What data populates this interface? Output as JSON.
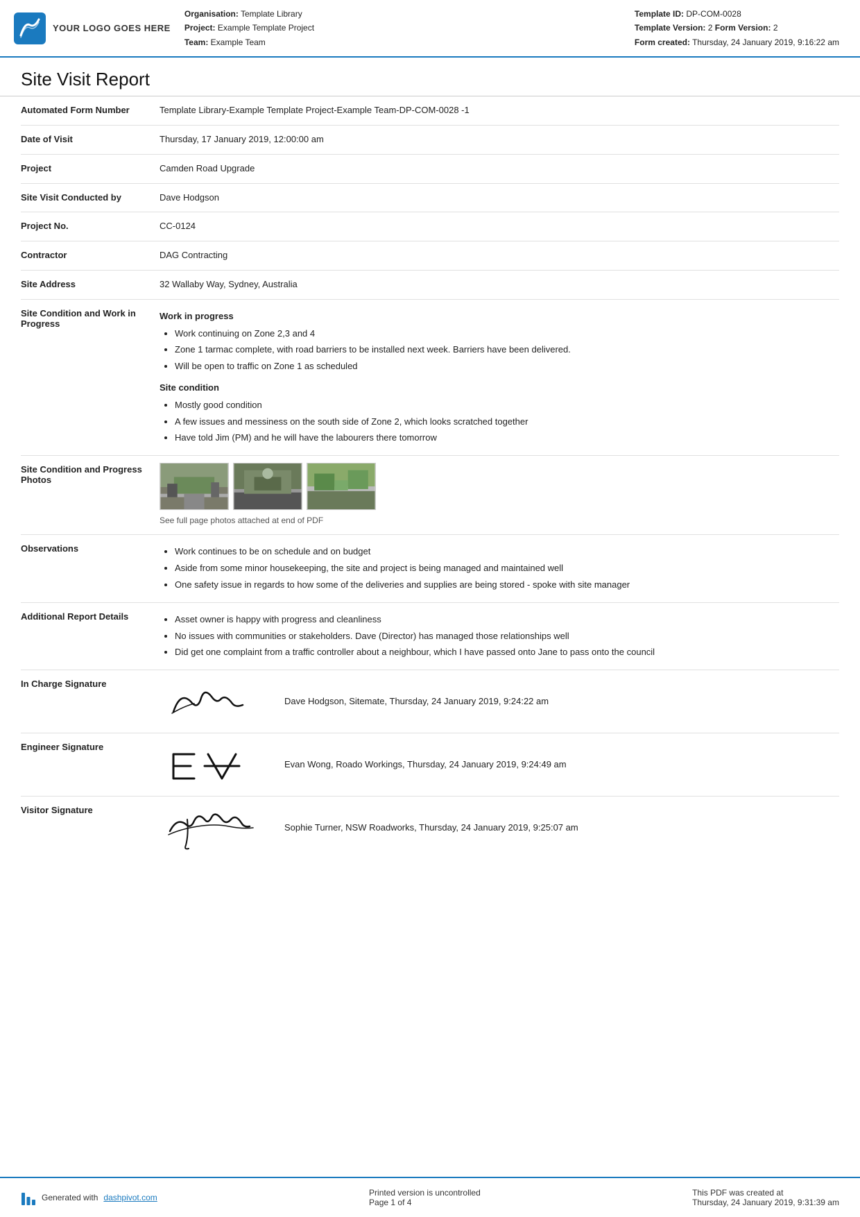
{
  "header": {
    "logo_text": "YOUR LOGO GOES HERE",
    "org_label": "Organisation:",
    "org_value": "Template Library",
    "project_label": "Project:",
    "project_value": "Example Template Project",
    "team_label": "Team:",
    "team_value": "Example Team",
    "template_id_label": "Template ID:",
    "template_id_value": "DP-COM-0028",
    "template_version_label": "Template Version:",
    "template_version_value": "2",
    "form_version_label": "Form Version:",
    "form_version_value": "2",
    "form_created_label": "Form created:",
    "form_created_value": "Thursday, 24 January 2019, 9:16:22 am"
  },
  "report": {
    "title": "Site Visit Report",
    "fields": [
      {
        "label": "Automated Form Number",
        "value": "Template Library-Example Template Project-Example Team-DP-COM-0028   -1"
      },
      {
        "label": "Date of Visit",
        "value": "Thursday, 17 January 2019, 12:00:00 am"
      },
      {
        "label": "Project",
        "value": "Camden Road Upgrade"
      },
      {
        "label": "Site Visit Conducted by",
        "value": "Dave Hodgson"
      },
      {
        "label": "Project No.",
        "value": "CC-0124"
      },
      {
        "label": "Contractor",
        "value": "DAG Contracting"
      },
      {
        "label": "Site Address",
        "value": "32 Wallaby Way, Sydney, Australia"
      }
    ],
    "site_condition": {
      "label": "Site Condition and Work in Progress",
      "work_header": "Work in progress",
      "work_items": [
        "Work continuing on Zone 2,3 and 4",
        "Zone 1 tarmac complete, with road barriers to be installed next week. Barriers have been delivered.",
        "Will be open to traffic on Zone 1 as scheduled"
      ],
      "condition_header": "Site condition",
      "condition_items": [
        "Mostly good condition",
        "A few issues and messiness on the south side of Zone 2, which looks scratched together",
        "Have told Jim (PM) and he will have the labourers there tomorrow"
      ]
    },
    "photos": {
      "label": "Site Condition and Progress Photos",
      "caption": "See full page photos attached at end of PDF"
    },
    "observations": {
      "label": "Observations",
      "items": [
        "Work continues to be on schedule and on budget",
        "Aside from some minor housekeeping, the site and project is being managed and maintained well",
        "One safety issue in regards to how some of the deliveries and supplies are being stored - spoke with site manager"
      ]
    },
    "additional": {
      "label": "Additional Report Details",
      "items": [
        "Asset owner is happy with progress and cleanliness",
        "No issues with communities or stakeholders. Dave (Director) has managed those relationships well",
        "Did get one complaint from a traffic controller about a neighbour, which I have passed onto Jane to pass onto the council"
      ]
    },
    "signatures": [
      {
        "label": "In Charge Signature",
        "text": "Dave Hodgson, Sitemate, Thursday, 24 January 2019, 9:24:22 am",
        "sig_type": "cursive"
      },
      {
        "label": "Engineer Signature",
        "text": "Evan Wong, Roado Workings, Thursday, 24 January 2019, 9:24:49 am",
        "sig_type": "print"
      },
      {
        "label": "Visitor Signature",
        "text": "Sophie Turner, NSW Roadworks, Thursday, 24 January 2019, 9:25:07 am",
        "sig_type": "cursive2"
      }
    ]
  },
  "footer": {
    "generated_text": "Generated with",
    "link_text": "dashpivot.com",
    "middle_text": "Printed version is uncontrolled",
    "page_text": "Page 1 of 4",
    "right_text": "This PDF was created at",
    "right_date": "Thursday, 24 January 2019, 9:31:39 am"
  }
}
